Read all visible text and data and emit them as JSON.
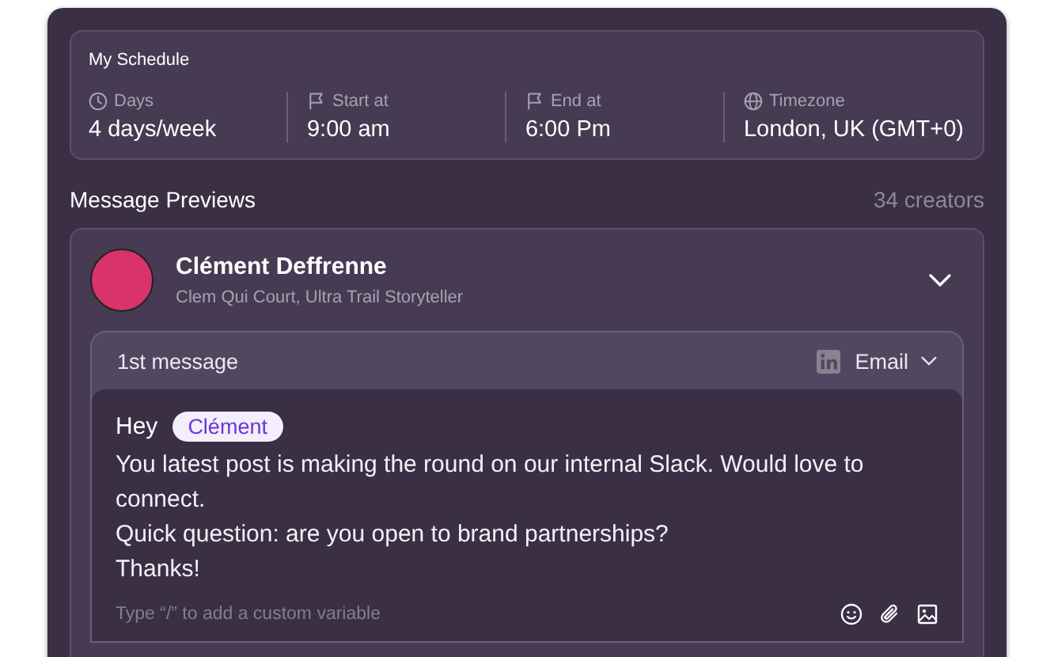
{
  "schedule": {
    "title": "My Schedule",
    "fields": [
      {
        "kind": "days",
        "label": "Days",
        "value": "4 days/week"
      },
      {
        "kind": "start",
        "label": "Start at",
        "value": "9:00 am"
      },
      {
        "kind": "end",
        "label": "End at",
        "value": "6:00 Pm"
      },
      {
        "kind": "timezone",
        "label": "Timezone",
        "value": "London, UK (GMT+0)"
      }
    ]
  },
  "message_previews": {
    "title": "Message Previews",
    "count": "34 creators"
  },
  "creator": {
    "name": "Clément Deffrenne",
    "subtitle": "Clem Qui Court, Ultra Trail Storyteller"
  },
  "message": {
    "label": "1st message",
    "channel": "Email",
    "greeting": "Hey",
    "variable": "Clément",
    "paragraphs": [
      "You latest post is making the round on our internal Slack. Would love to connect.",
      "Quick question: are you open to brand partnerships?",
      "Thanks!"
    ],
    "hint": "Type “/” to add a custom variable"
  }
}
